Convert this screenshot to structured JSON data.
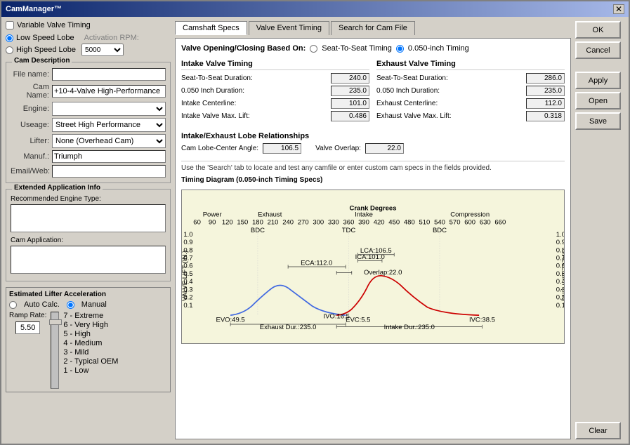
{
  "window": {
    "title": "CamManager™",
    "close_label": "✕"
  },
  "left": {
    "variable_valve_timing_label": "Variable Valve Timing",
    "low_speed_lobe_label": "Low Speed Lobe",
    "high_speed_lobe_label": "High Speed Lobe",
    "activation_rpm_label": "Activation RPM:",
    "activation_rpm_value": "5000",
    "cam_description_label": "Cam Description",
    "file_name_label": "File name:",
    "cam_name_label": "Cam Name:",
    "cam_name_value": "+10-4-Valve High-Performance",
    "engine_label": "Engine:",
    "engine_value": "",
    "usage_label": "Useage:",
    "usage_value": "Street High Performance",
    "lifter_label": "Lifter:",
    "lifter_value": "None (Overhead Cam)",
    "manuf_label": "Manuf.:",
    "manuf_value": "Triumph",
    "email_label": "Email/Web:",
    "email_value": "",
    "extended_info_label": "Extended Application Info",
    "recommended_engine_label": "Recommended Engine Type:",
    "cam_application_label": "Cam Application:",
    "estimated_lifter_label": "Estimated Lifter Acceleration",
    "auto_label": "Auto Calc.",
    "manual_label": "Manual",
    "ramp_rate_label": "Ramp Rate:",
    "ramp_rate_value": "5.50",
    "ramp_levels": [
      "7 - Extreme",
      "6 - Very High",
      "5 - High",
      "4 - Medium",
      "3 - Mild",
      "2 - Typical OEM",
      "1 - Low"
    ]
  },
  "tabs": {
    "camshaft_specs": "Camshaft Specs",
    "valve_event_timing": "Valve Event Timing",
    "search_for_cam_file": "Search for Cam File"
  },
  "specs": {
    "valve_opening_label": "Valve Opening/Closing Based On:",
    "seat_to_seat_label": "Seat-To-Seat Timing",
    "inch_050_label": "0.050-inch Timing",
    "intake_header": "Intake Valve Timing",
    "exhaust_header": "Exhaust Valve Timing",
    "intake_rows": [
      {
        "label": "Seat-To-Seat Duration:",
        "value": "240.0"
      },
      {
        "label": "0.050 Inch Duration:",
        "value": "235.0"
      },
      {
        "label": "Intake Centerline:",
        "value": "101.0"
      },
      {
        "label": "Intake Valve Max. Lift:",
        "value": "0.486"
      }
    ],
    "exhaust_rows": [
      {
        "label": "Seat-To-Seat Duration:",
        "value": "286.0"
      },
      {
        "label": "0.050 Inch Duration:",
        "value": "235.0"
      },
      {
        "label": "Exhaust Centerline:",
        "value": "112.0"
      },
      {
        "label": "Exhaust Valve Max. Lift:",
        "value": "0.318"
      }
    ],
    "lobe_section_label": "Intake/Exhaust Lobe Relationships",
    "cam_lobe_label": "Cam Lobe-Center Angle:",
    "cam_lobe_value": "106.5",
    "valve_overlap_label": "Valve Overlap:",
    "valve_overlap_value": "22.0",
    "info_text": "Use the 'Search' tab to locate and test any camfile or enter custom cam specs in the fields provided.",
    "diagram_label": "Timing Diagram (0.050-inch Timing Specs)"
  },
  "buttons": {
    "ok": "OK",
    "cancel": "Cancel",
    "apply": "Apply",
    "open": "Open",
    "save": "Save",
    "clear": "Clear"
  },
  "diagram": {
    "title": "Crank Degrees",
    "exhaust_label": "Exhaust",
    "intake_label": "Intake",
    "compression_label": "Compression",
    "power_label": "Power",
    "lca_label": "LCA:106.5",
    "ica_label": "ICA:101.0",
    "eca_label": "ECA:112.0",
    "overlap_label": "Overlap:22.0",
    "evo_label": "EVO:49.5",
    "ivo_label": "IVO:16.5",
    "evc_label": "EVC:5.5",
    "ivc_label": "IVC:38.5",
    "exhaust_dur_label": "Exhaust Dur.:235.0",
    "intake_dur_label": "Intake Dur.:235.0",
    "y_axis_label": "VALVE LIFT (IN.)"
  }
}
